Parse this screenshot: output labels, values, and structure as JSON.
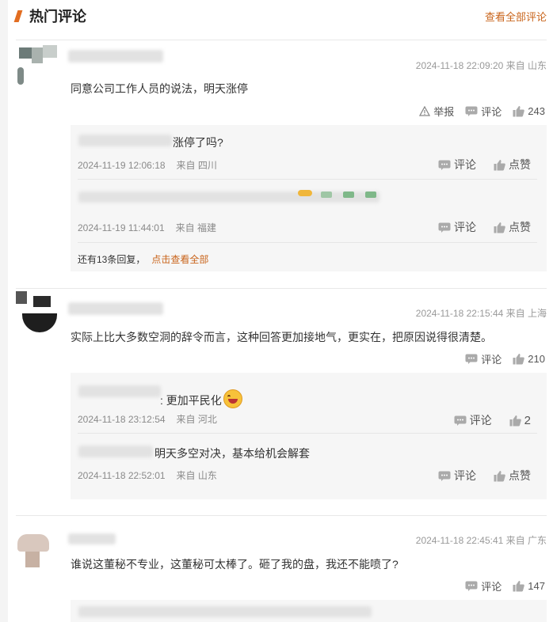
{
  "header": {
    "title": "热门评论",
    "view_all": "查看全部评论"
  },
  "comments": [
    {
      "meta": "2024-11-18 22:09:20 来自 山东",
      "text": "同意公司工作人员的说法，明天涨停",
      "report": "举报",
      "comment": "评论",
      "likes": "243",
      "replies": [
        {
          "text": "涨停了吗?",
          "time": "2024-11-19 12:06:18",
          "location": "来自 四川",
          "comment": "评论",
          "like": "点赞"
        },
        {
          "text": "",
          "time": "2024-11-19 11:44:01",
          "location": "来自 福建",
          "comment": "评论",
          "like": "点赞"
        }
      ],
      "more_count": "还有13条回复，",
      "more_link": "点击查看全部"
    },
    {
      "meta": "2024-11-18 22:15:44 来自 上海",
      "text": "实际上比大多数空洞的辞令而言，这种回答更加接地气，更实在，把原因说得很清楚。",
      "comment": "评论",
      "likes": "210",
      "replies": [
        {
          "text": ": 更加平民化",
          "time": "2024-11-18 23:12:54",
          "location": "来自 河北",
          "comment": "评论",
          "like": "2"
        },
        {
          "text": "明天多空对决，基本给机会解套",
          "time": "2024-11-18 22:52:01",
          "location": "来自 山东",
          "comment": "评论",
          "like": "点赞"
        }
      ]
    },
    {
      "meta": "2024-11-18 22:45:41 来自 广东",
      "text": "谁说这董秘不专业，这董秘可太棒了。砸了我的盘，我还不能喷了?",
      "comment": "评论",
      "likes": "147"
    }
  ]
}
